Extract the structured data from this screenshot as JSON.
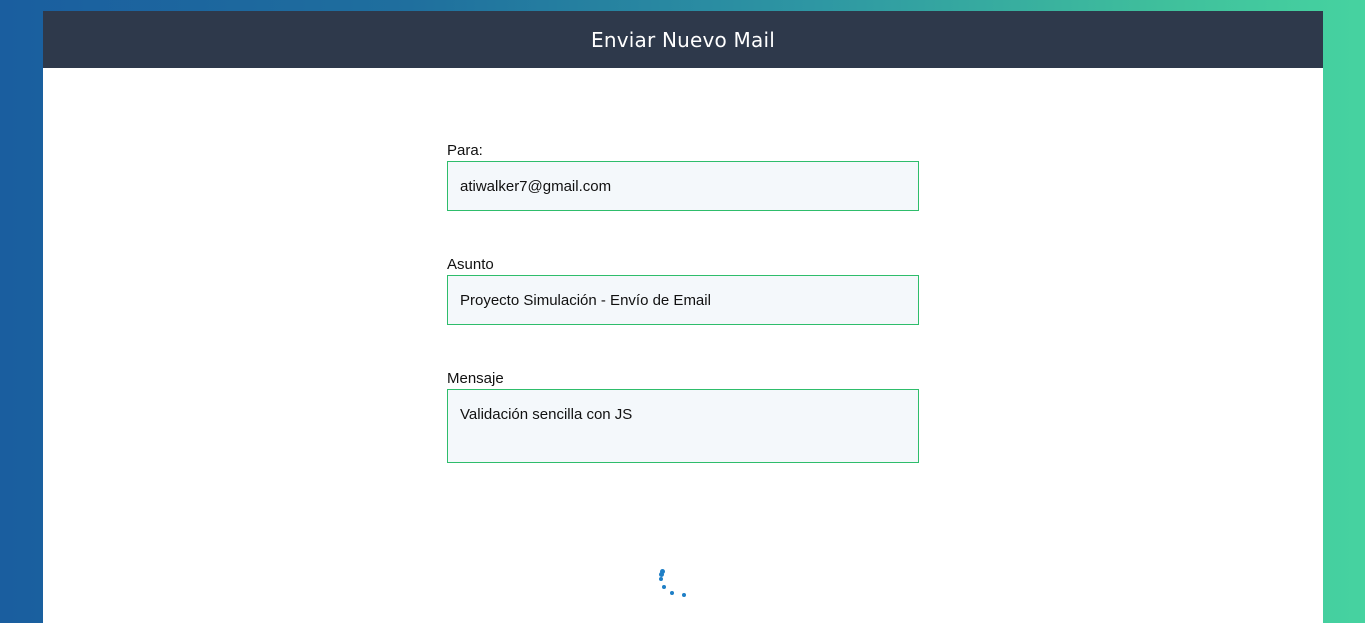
{
  "header": {
    "title": "Enviar Nuevo Mail"
  },
  "form": {
    "to": {
      "label": "Para:",
      "value": "atiwalker7@gmail.com"
    },
    "subject": {
      "label": "Asunto",
      "value": "Proyecto Simulación - Envío de Email"
    },
    "message": {
      "label": "Mensaje",
      "value": "Validación sencilla con JS"
    }
  },
  "colors": {
    "header_bg": "#2e394b",
    "input_border": "#2ebd6b",
    "input_bg": "#f4f8fb",
    "spinner": "#1f7fc6",
    "gradient_left": "#1a5e9f",
    "gradient_right": "#46d3a0"
  },
  "spinner": {
    "icon": "loading-spinner-icon"
  }
}
